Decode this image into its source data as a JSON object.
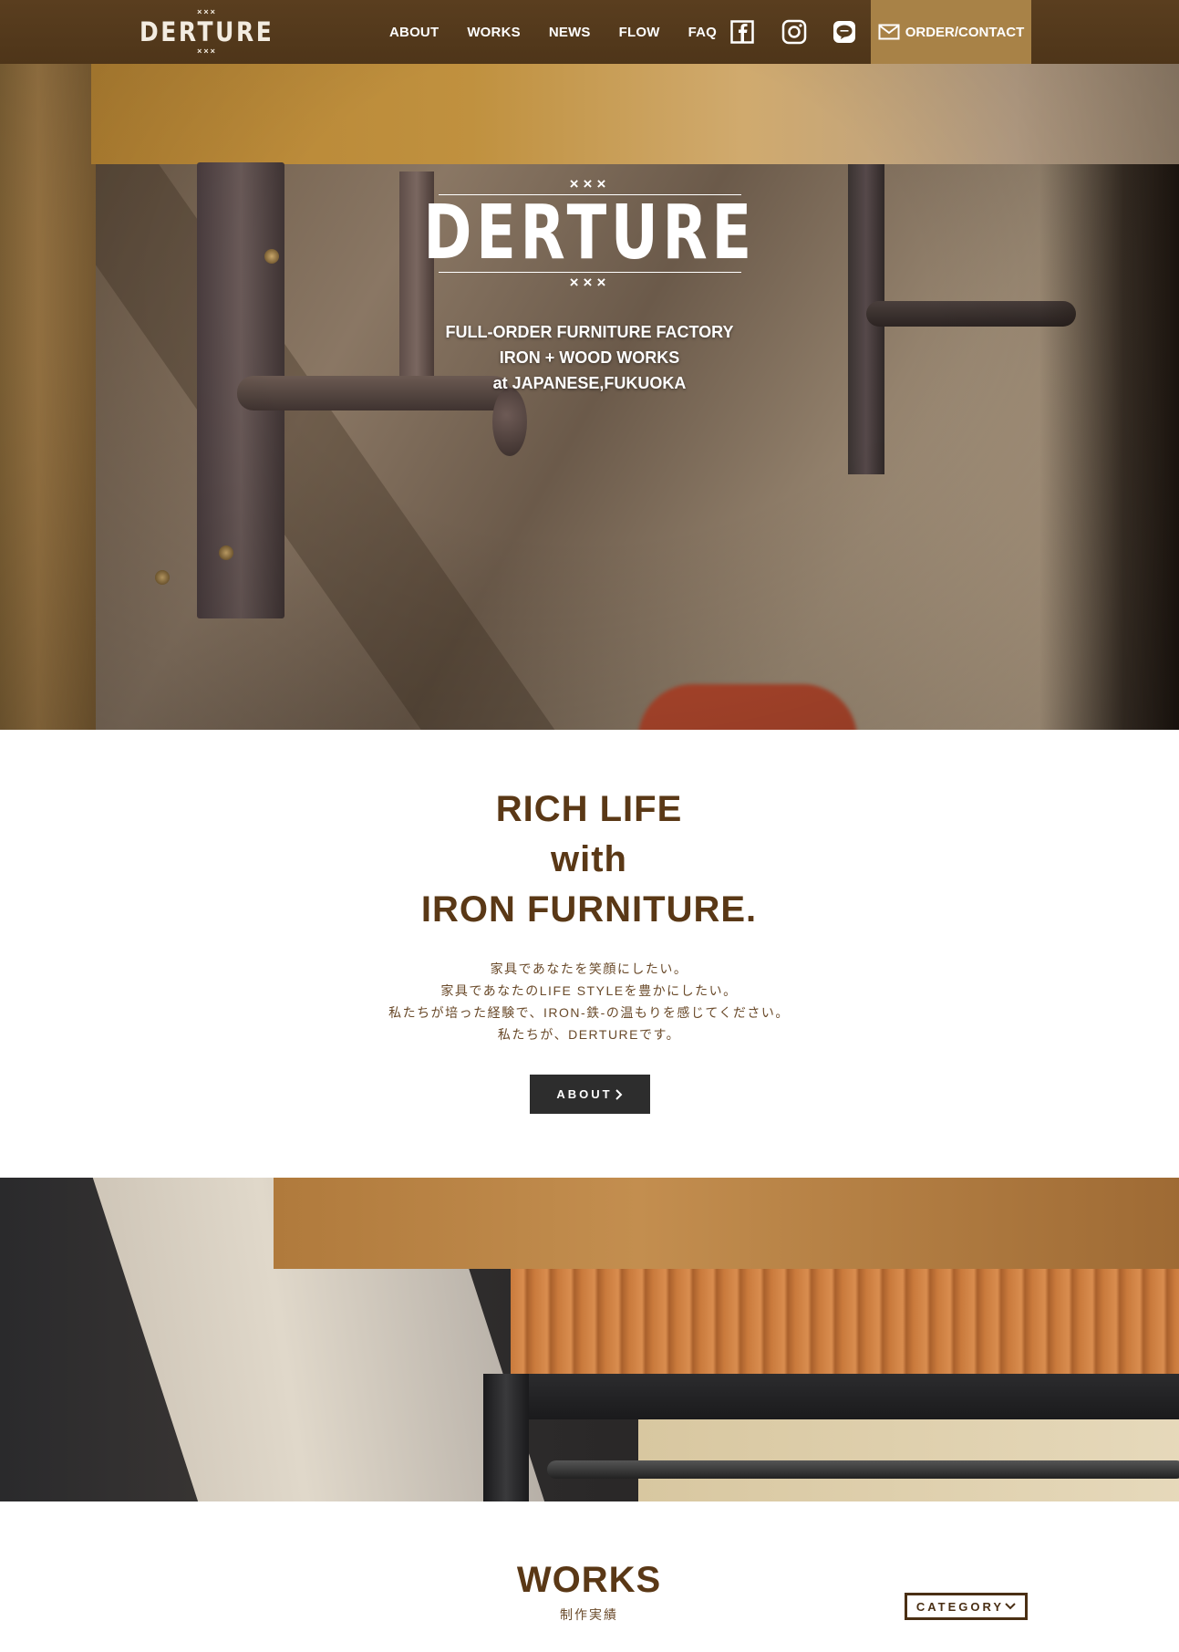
{
  "header": {
    "logo": {
      "top": "×××",
      "word": "DERTURE",
      "bottom": "×××"
    },
    "nav": [
      {
        "label": "ABOUT"
      },
      {
        "label": "WORKS"
      },
      {
        "label": "NEWS"
      },
      {
        "label": "FLOW"
      },
      {
        "label": "FAQ"
      }
    ],
    "social": [
      "facebook-icon",
      "instagram-icon",
      "line-icon"
    ],
    "order_label": "ORDER/CONTACT"
  },
  "hero": {
    "logo": {
      "top": "×××",
      "word": "DERTURE",
      "bottom": "×××"
    },
    "tagline": [
      "FULL-ORDER FURNITURE FACTORY",
      "IRON + WOOD WORKS",
      "at JAPANESE,FUKUOKA"
    ]
  },
  "intro": {
    "title": [
      "RICH LIFE",
      "with",
      "IRON FURNITURE."
    ],
    "lines": [
      "家具であなたを笑顔にしたい。",
      "家具であなたのLIFE STYLEを豊かにしたい。",
      "私たちが培った経験で、IRON-鉄-の温もりを感じてください。",
      "私たちが、DERTUREです。"
    ],
    "button_label": "ABOUT"
  },
  "works": {
    "title": "WORKS",
    "subtitle": "制作実績",
    "category_label": "CATEGORY"
  },
  "colors": {
    "header_bg": "#543a1c",
    "order_bg": "#a88247",
    "heading": "#5a3816",
    "dark_button": "#2d2d2d"
  }
}
